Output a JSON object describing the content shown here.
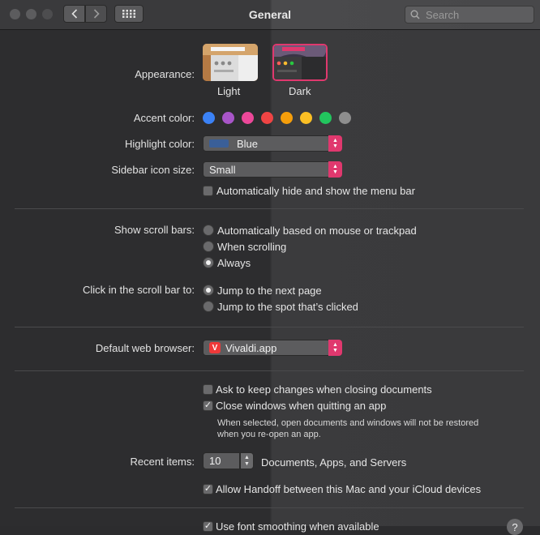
{
  "window": {
    "title": "General"
  },
  "search": {
    "placeholder": "Search"
  },
  "appearance": {
    "label": "Appearance:",
    "options": [
      {
        "name": "Light"
      },
      {
        "name": "Dark"
      }
    ],
    "selected": "Dark"
  },
  "accent": {
    "label": "Accent color:",
    "colors": [
      "#3b82f6",
      "#a855c8",
      "#ec4899",
      "#ef4444",
      "#f59e0b",
      "#fbbf24",
      "#22c55e",
      "#8e8e8e"
    ]
  },
  "highlight": {
    "label": "Highlight color:",
    "value": "Blue",
    "swatch": "#3a5f98"
  },
  "sidebar_icon": {
    "label": "Sidebar icon size:",
    "value": "Small"
  },
  "menu_bar": {
    "label": "Automatically hide and show the menu bar",
    "checked": false
  },
  "scroll_bars": {
    "label": "Show scroll bars:",
    "options": [
      "Automatically based on mouse or trackpad",
      "When scrolling",
      "Always"
    ],
    "selected": "Always"
  },
  "click_scroll": {
    "label": "Click in the scroll bar to:",
    "options": [
      "Jump to the next page",
      "Jump to the spot that’s clicked"
    ],
    "selected": "Jump to the next page"
  },
  "browser": {
    "label": "Default web browser:",
    "value": "Vivaldi.app",
    "icon_color": "#ef3939"
  },
  "ask_keep": {
    "label": "Ask to keep changes when closing documents",
    "checked": false
  },
  "close_windows": {
    "label": "Close windows when quitting an app",
    "checked": true,
    "note_line1": "When selected, open documents and windows will not be restored",
    "note_line2": "when you re-open an app."
  },
  "recent": {
    "label": "Recent items:",
    "value": "10",
    "suffix": "Documents, Apps, and Servers"
  },
  "handoff": {
    "label": "Allow Handoff between this Mac and your iCloud devices",
    "checked": true
  },
  "font_smoothing": {
    "label": "Use font smoothing when available",
    "checked": true
  },
  "accent_pink": "#e0386e"
}
